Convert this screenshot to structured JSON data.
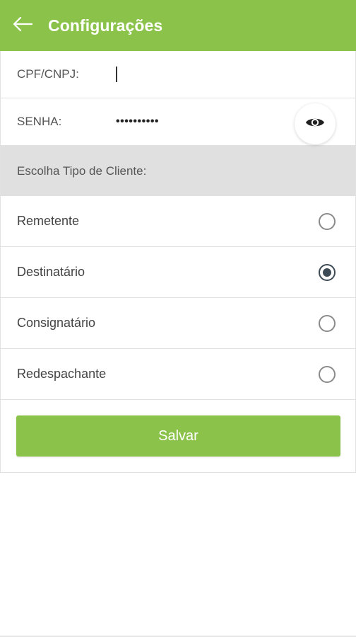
{
  "header": {
    "title": "Configurações",
    "back_icon": "arrow-left-icon",
    "color": "#8bc34a"
  },
  "fields": {
    "cpf_label": "CPF/CNPJ:",
    "cpf_value": "",
    "senha_label": "SENHA:",
    "senha_value": "••••••••••",
    "eye_icon": "eye-icon"
  },
  "client_type": {
    "header": "Escolha Tipo de Cliente:",
    "options": [
      {
        "label": "Remetente",
        "selected": false
      },
      {
        "label": "Destinatário",
        "selected": true
      },
      {
        "label": "Consignatário",
        "selected": false
      },
      {
        "label": "Redespachante",
        "selected": false
      }
    ]
  },
  "actions": {
    "save_label": "Salvar"
  }
}
